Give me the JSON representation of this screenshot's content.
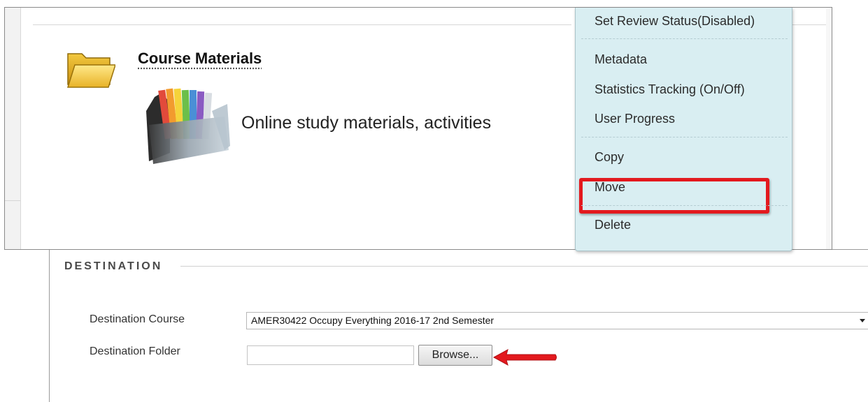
{
  "course_item": {
    "title": "Course Materials",
    "description": "Online study materials, activities",
    "folder_icon": "folder-icon",
    "image_icon": "file-folders-image"
  },
  "context_menu": {
    "items": [
      {
        "label": "Set Review Status(Disabled)"
      },
      {
        "label": "Metadata"
      },
      {
        "label": "Statistics Tracking (On/Off)"
      },
      {
        "label": "User Progress"
      },
      {
        "label": "Copy"
      },
      {
        "label": "Move"
      },
      {
        "label": "Delete"
      }
    ],
    "highlighted_item": "Move",
    "highlight_color": "#e3191e",
    "background_color": "#d9eef2"
  },
  "destination": {
    "heading": "DESTINATION",
    "course_label": "Destination Course",
    "course_value": "AMER30422 Occupy Everything 2016-17 2nd Semester",
    "folder_label": "Destination Folder",
    "folder_value": "",
    "browse_label": "Browse...",
    "arrow_icon": "red-arrow-left-icon",
    "arrow_color": "#e3191e"
  }
}
